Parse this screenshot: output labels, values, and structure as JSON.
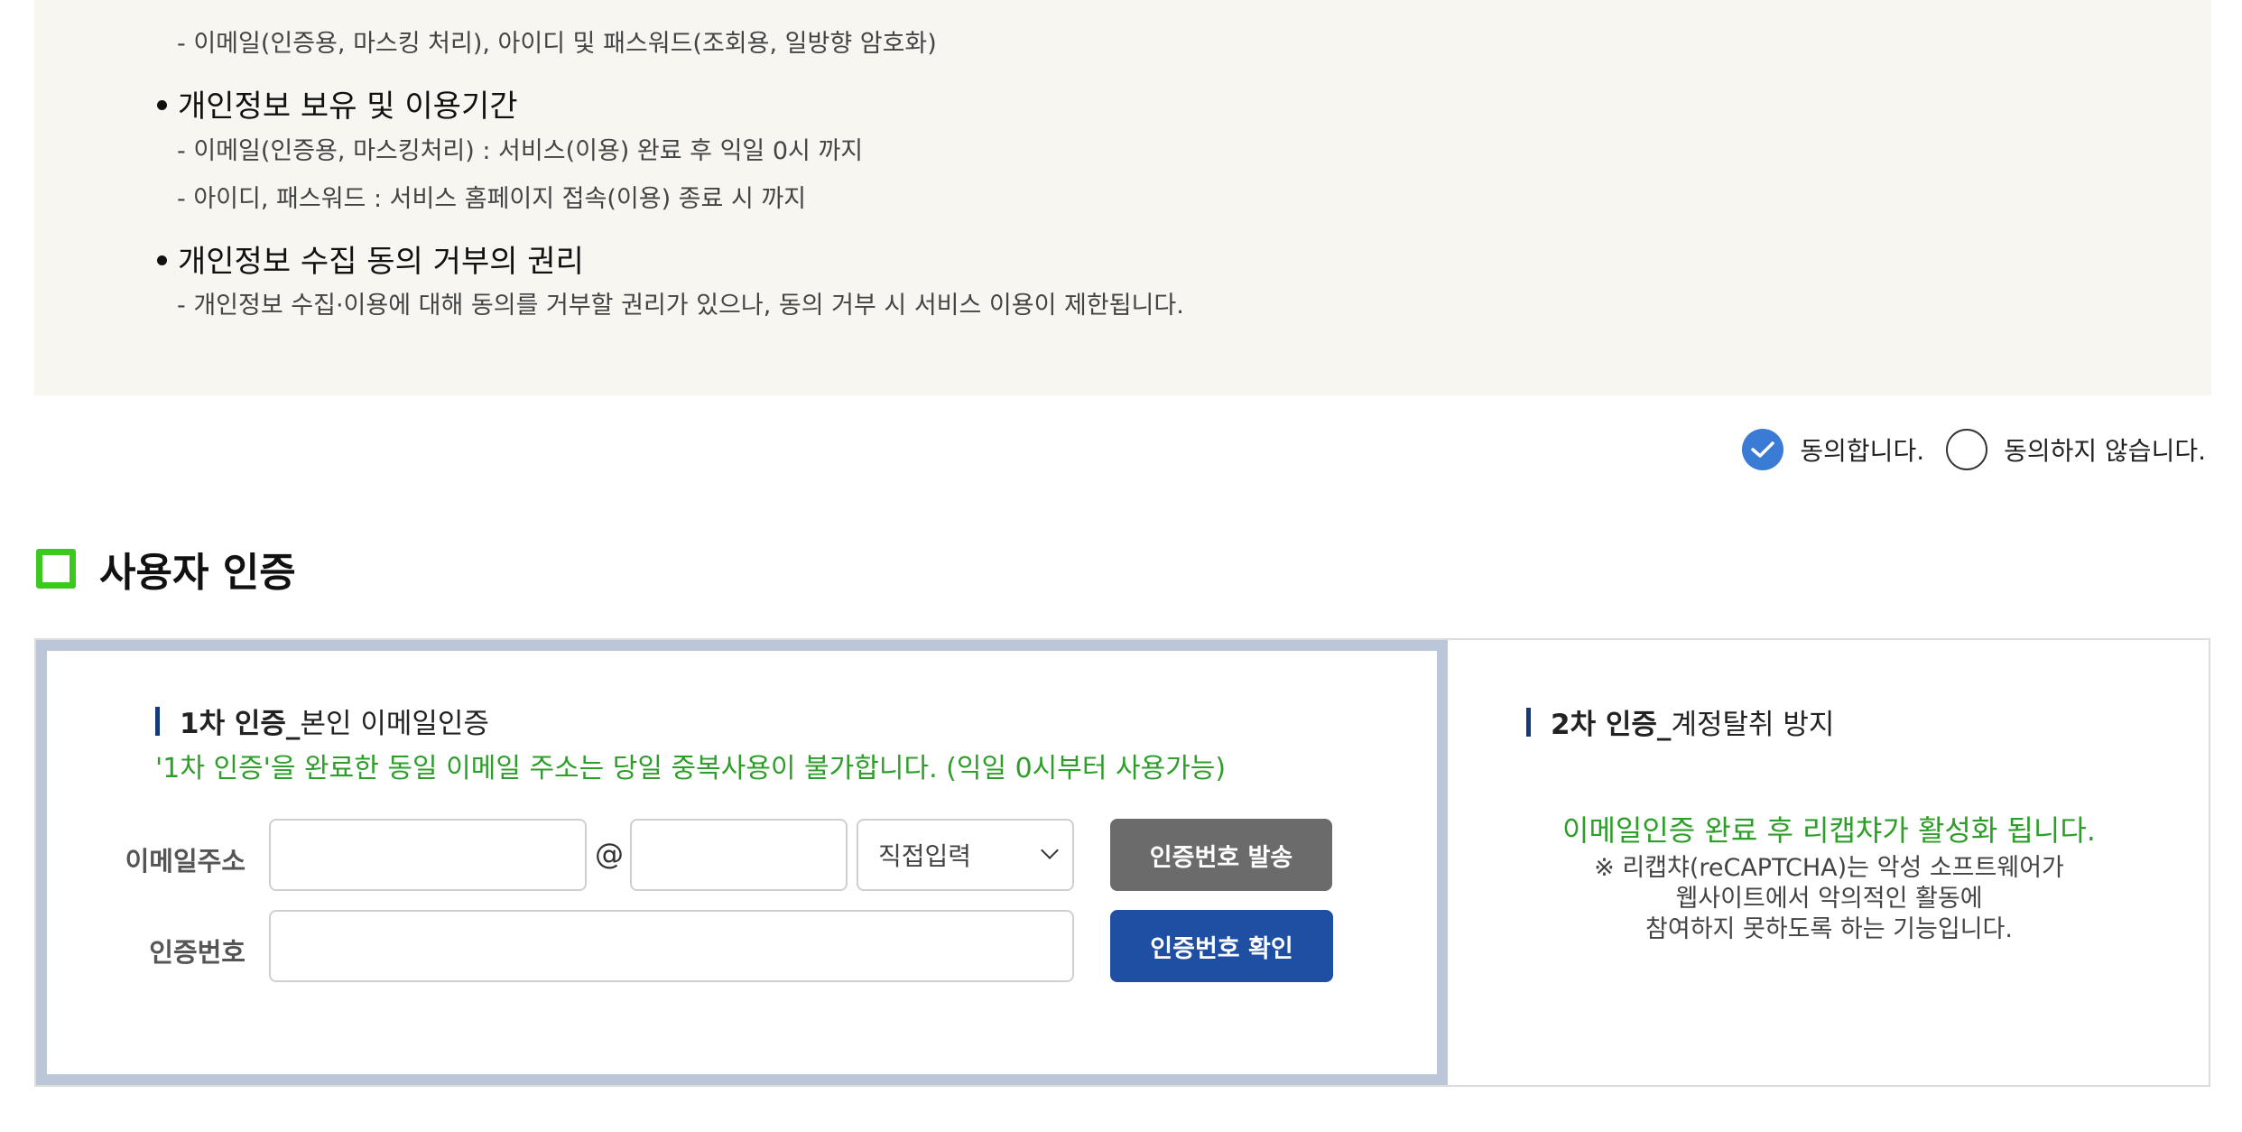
{
  "policy": {
    "item1_detail": "- 이메일(인증용, 마스킹 처리), 아이디 및 패스워드(조회용, 일방향 암호화)",
    "item2_title": "개인정보 보유 및 이용기간",
    "item2_detail1": "- 이메일(인증용, 마스킹처리) : 서비스(이용) 완료 후 익일 0시 까지",
    "item2_detail2": "- 아이디, 패스워드 : 서비스 홈페이지 접속(이용) 종료 시 까지",
    "item3_title": "개인정보 수집 동의 거부의 권리",
    "item3_detail": "- 개인정보 수집·이용에 대해 동의를 거부할 권리가 있으나, 동의 거부 시 서비스 이용이 제한됩니다."
  },
  "consent": {
    "agree_label": "동의합니다.",
    "disagree_label": "동의하지 않습니다.",
    "selected": "agree",
    "accent_color": "#3a7bd5"
  },
  "section": {
    "title": "사용자 인증",
    "icon": "green-square-icon"
  },
  "auth1": {
    "head_bold": "1차 인증_",
    "head_rest": "본인 이메일인증",
    "notice": "'1차 인증'을 완료한 동일 이메일 주소는 당일 중복사용이 불가합니다. (익일 0시부터 사용가능)",
    "email_label": "이메일주소",
    "at_symbol": "@",
    "domain_select_value": "직접입력",
    "send_button": "인증번호 발송",
    "code_label": "인증번호",
    "confirm_button": "인증번호 확인"
  },
  "auth2": {
    "head_bold": "2차 인증_",
    "head_rest": "계정탈취 방지",
    "green_msg": "이메일인증 완료 후 리캡챠가 활성화 됩니다.",
    "note_line1": "※ 리캡챠(reCAPTCHA)는 악성 소프트웨어가",
    "note_line2": "웹사이트에서 악의적인 활동에",
    "note_line3": "참여하지 못하도록 하는 기능입니다."
  },
  "colors": {
    "green": "#2e9e2a",
    "section_icon": "#3cc81e",
    "primary_button": "#1f4fa3",
    "secondary_button": "#6b6b6b"
  }
}
